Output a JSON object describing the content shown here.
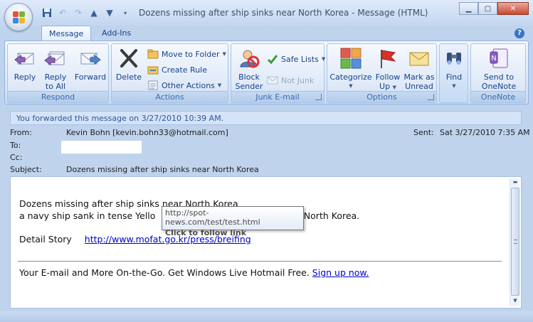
{
  "window": {
    "title": "Dozens missing after ship sinks near North Korea - Message (HTML)"
  },
  "tabs": [
    {
      "label": "Message",
      "active": true
    },
    {
      "label": "Add-Ins",
      "active": false
    }
  ],
  "ribbon": {
    "respond": {
      "label": "Respond",
      "reply": "Reply",
      "reply_all_1": "Reply",
      "reply_all_2": "to All",
      "forward": "Forward"
    },
    "actions": {
      "label": "Actions",
      "delete": "Delete",
      "move_to_folder": "Move to Folder",
      "create_rule": "Create Rule",
      "other_actions": "Other Actions"
    },
    "junk": {
      "label": "Junk E-mail",
      "block_1": "Block",
      "block_2": "Sender",
      "safe_lists": "Safe Lists",
      "not_junk": "Not Junk"
    },
    "options": {
      "label": "Options",
      "categorize": "Categorize",
      "follow_1": "Follow",
      "follow_2": "Up",
      "mark_1": "Mark as",
      "mark_2": "Unread"
    },
    "find": {
      "label": "Find"
    },
    "onenote": {
      "label": "OneNote",
      "send_1": "Send to",
      "send_2": "OneNote"
    }
  },
  "infobar": "You forwarded this message on 3/27/2010 10:39 AM.",
  "header": {
    "from_label": "From:",
    "from_value": "Kevin Bohn [kevin.bohn33@hotmail.com]",
    "sent_label": "Sent:",
    "sent_value": "Sat 3/27/2010 7:35 AM",
    "to_label": "To:",
    "cc_label": "Cc:",
    "subject_label": "Subject:",
    "subject_value": "Dozens missing after ship sinks near North Korea"
  },
  "body": {
    "line1": "Dozens missing after ship sinks near North Korea",
    "line2_start": "a navy ship sank in tense Yello",
    "line2_end": "f North Korea.",
    "detail_label": "Detail Story",
    "detail_link": "http://www.mofat.go.kr/press/breifing",
    "footer_text": "Your E-mail and More On-the-Go. Get Windows Live Hotmail Free.",
    "footer_link": "Sign up now."
  },
  "tooltip": {
    "url": "http://spot-news.com/test/test.html",
    "hint": "Click to follow link"
  },
  "colors": {
    "accent": "#15428b",
    "link": "#0000cc",
    "ribbon_bg": "#dbe7f7"
  }
}
